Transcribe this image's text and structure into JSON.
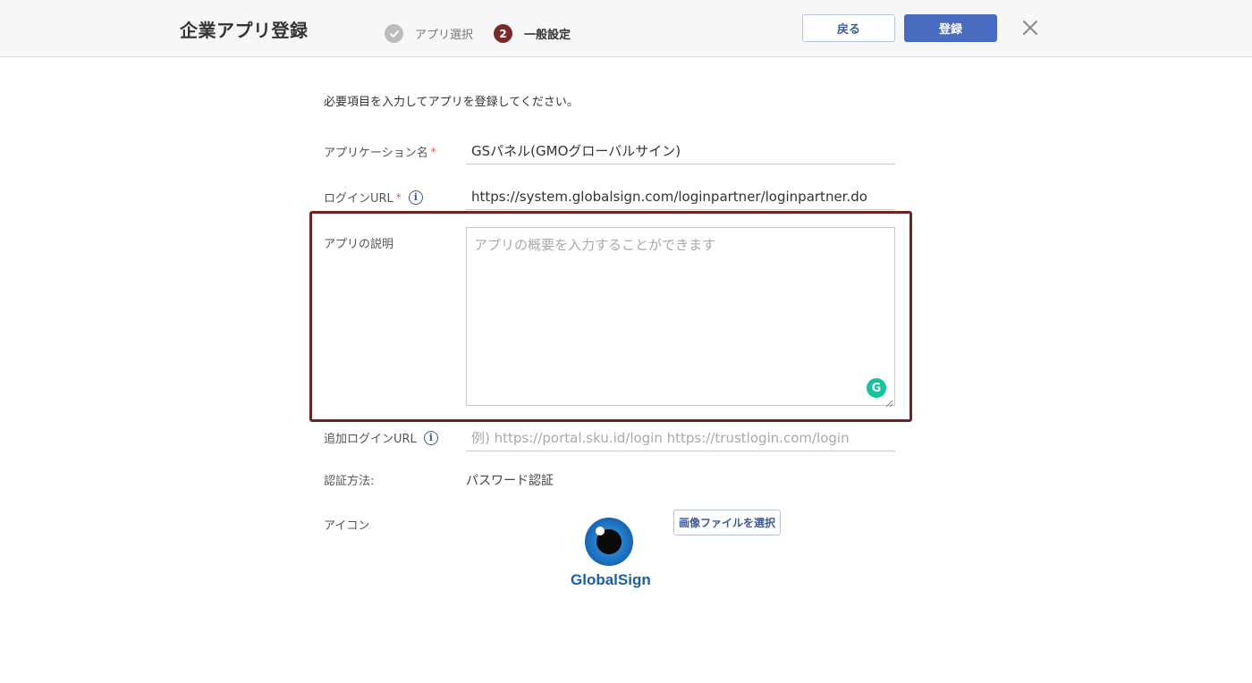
{
  "header": {
    "title": "企業アプリ登録",
    "steps": [
      {
        "label": "アプリ選択",
        "status": "done",
        "number": "✓"
      },
      {
        "label": "一般設定",
        "status": "current",
        "number": "2"
      }
    ],
    "back_label": "戻る",
    "submit_label": "登録",
    "close_icon": "close-icon"
  },
  "form": {
    "intro": "必要項目を入力してアプリを登録してください。",
    "required_mark": "*",
    "app_name": {
      "label": "アプリケーション名",
      "value": "GSパネル(GMOグローバルサイン)"
    },
    "login_url": {
      "label": "ログインURL",
      "value": "https://system.globalsign.com/loginpartner/loginpartner.do"
    },
    "description": {
      "label": "アプリの説明",
      "placeholder": "アプリの概要を入力することができます"
    },
    "additional_url": {
      "label": "追加ログインURL",
      "placeholder": "例) https://portal.sku.id/login https://trustlogin.com/login"
    },
    "auth_method": {
      "label": "認証方法:",
      "value": "パスワード認証"
    },
    "icon": {
      "label": "アイコン",
      "select_button": "画像ファイルを選択",
      "logo_text": "GlobalSign"
    }
  },
  "colors": {
    "accent": "#4a6cc0",
    "highlight_border": "#6e2424",
    "step_current": "#7b2a2a",
    "required": "#d9534f",
    "grammarly": "#15c39a",
    "logo_blue": "#1a73c2"
  }
}
